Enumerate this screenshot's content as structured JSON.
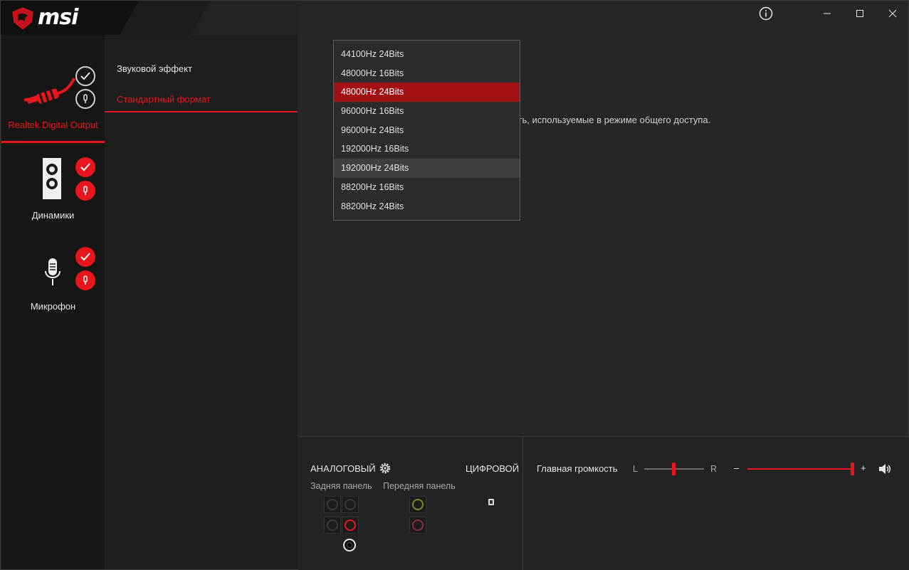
{
  "brand": {
    "name": "msi"
  },
  "devices": [
    {
      "label": "Realtek Digital Output",
      "active": true
    },
    {
      "label": "Динамики",
      "active": false
    },
    {
      "label": "Микрофон",
      "active": false
    }
  ],
  "menu": {
    "items": [
      {
        "label": "Звуковой эффект",
        "active": false
      },
      {
        "label": "Стандартный формат",
        "active": true
      }
    ]
  },
  "content": {
    "description_visible": "сть, используемые в режиме общего доступа."
  },
  "format_dropdown": {
    "options": [
      "44100Hz 24Bits",
      "48000Hz 16Bits",
      "48000Hz 24Bits",
      "96000Hz 16Bits",
      "96000Hz 24Bits",
      "192000Hz 16Bits",
      "192000Hz 24Bits",
      "88200Hz 16Bits",
      "88200Hz 24Bits"
    ],
    "selected": "48000Hz 24Bits",
    "hovered": "192000Hz 24Bits"
  },
  "bottom_panel": {
    "analog_label": "АНАЛОГОВЫЙ",
    "digital_label": "ЦИФРОВОЙ",
    "rear_panel_label": "Задняя панель",
    "front_panel_label": "Передняя панель",
    "master_volume_label": "Главная громкость",
    "balance_left": "L",
    "balance_right": "R",
    "volume_minus": "–",
    "volume_plus": "+",
    "balance_value": 0.5,
    "volume_value": 1.0
  },
  "colors": {
    "accent": "#e8161c",
    "selected_bg": "#a31014",
    "jack_green": "#7a8a2a",
    "jack_pink": "#8a3040"
  }
}
